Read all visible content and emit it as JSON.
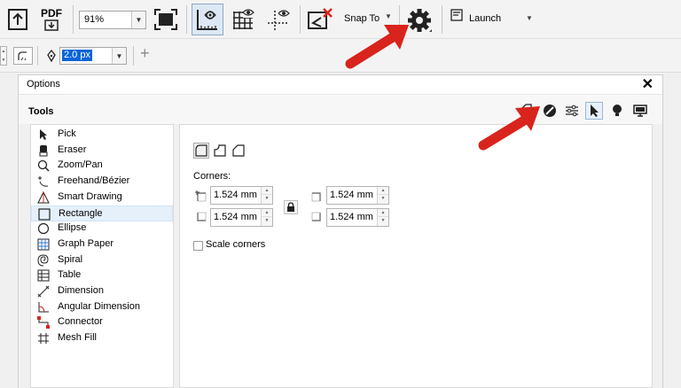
{
  "toolbar": {
    "zoom_value": "91%",
    "pdf_label": "PDF",
    "snap_label": "Snap To",
    "launch_label": "Launch",
    "outline_width": "2.0 px"
  },
  "options_window": {
    "title": "Options",
    "close_glyph": "✕",
    "section_title": "Tools",
    "tools": [
      {
        "label": "Pick",
        "icon": "pick-arrow-icon"
      },
      {
        "label": "Eraser",
        "icon": "eraser-icon"
      },
      {
        "label": "Zoom/Pan",
        "icon": "zoom-icon"
      },
      {
        "label": "Freehand/Bézier",
        "icon": "freehand-icon"
      },
      {
        "label": "Smart Drawing",
        "icon": "smart-drawing-icon"
      },
      {
        "label": "Rectangle",
        "icon": "rectangle-icon",
        "selected": true
      },
      {
        "label": "Ellipse",
        "icon": "ellipse-icon"
      },
      {
        "label": "Graph Paper",
        "icon": "graph-paper-icon"
      },
      {
        "label": "Spiral",
        "icon": "spiral-icon"
      },
      {
        "label": "Table",
        "icon": "table-icon"
      },
      {
        "label": "Dimension",
        "icon": "dimension-icon"
      },
      {
        "label": "Angular Dimension",
        "icon": "angular-dimension-icon"
      },
      {
        "label": "Connector",
        "icon": "connector-icon"
      },
      {
        "label": "Mesh Fill",
        "icon": "mesh-fill-icon"
      }
    ],
    "rectangle": {
      "corners_label": "Corners:",
      "corner_values": {
        "top_left": "1.524 mm",
        "bottom_left": "1.524 mm",
        "top_right": "1.524 mm",
        "bottom_right": "1.524 mm"
      },
      "scale_corners_label": "Scale corners",
      "scale_corners_checked": false
    }
  },
  "colors": {
    "selection": "#0a64d8",
    "list_selected": "#e5f0fb",
    "annotation_arrow": "#d8241c"
  }
}
